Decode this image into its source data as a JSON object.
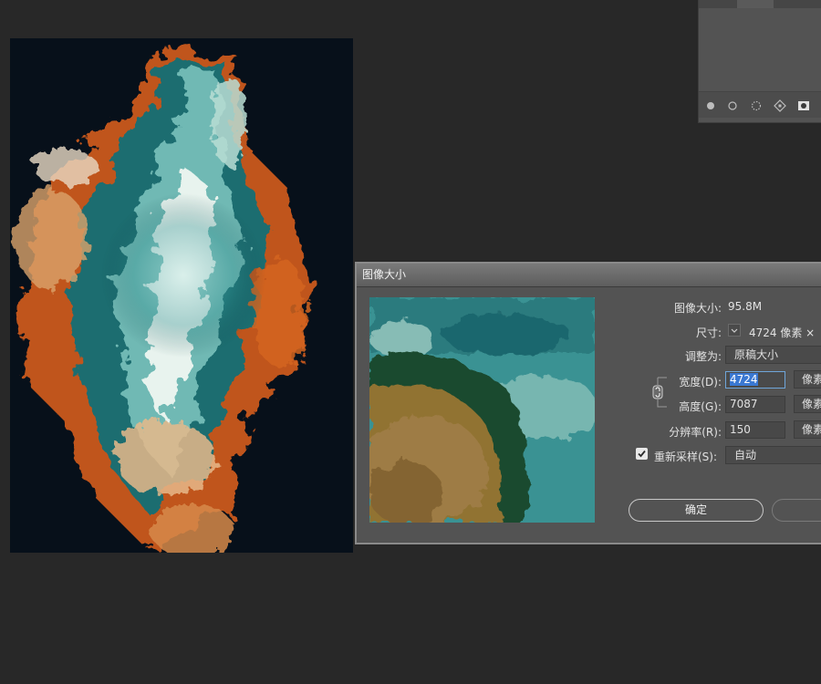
{
  "panel": {
    "icons": [
      "fill-circle-icon",
      "stroke-circle-icon",
      "dotted-selection-icon",
      "diamond-anchor-icon",
      "mask-icon"
    ]
  },
  "dialog": {
    "title": "图像大小",
    "size_label": "图像大小:",
    "size_value": "95.8M",
    "dimensions_label": "尺寸:",
    "dimensions_value": "4724 像素 ×",
    "fit_label": "调整为:",
    "fit_value": "原稿大小",
    "width_label": "宽度(D):",
    "width_value": "4724",
    "width_unit": "像素",
    "height_label": "高度(G):",
    "height_value": "7087",
    "height_unit": "像素",
    "resolution_label": "分辨率(R):",
    "resolution_value": "150",
    "resolution_unit": "像素",
    "resample_label": "重新采样(S):",
    "resample_checked": true,
    "resample_value": "自动",
    "ok_label": "确定",
    "cancel_label": ""
  }
}
